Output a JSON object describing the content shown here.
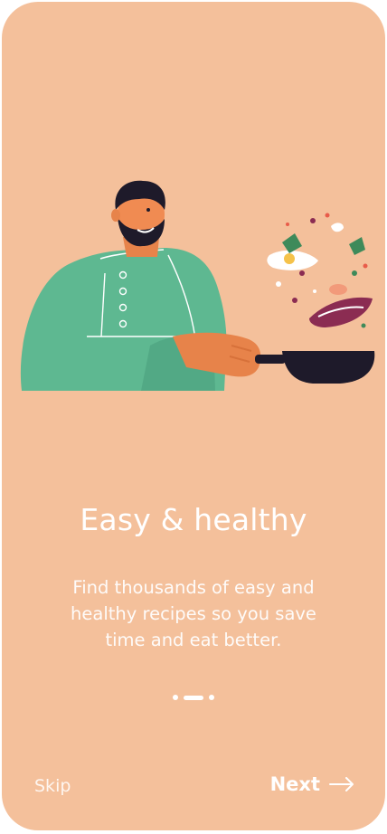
{
  "onboarding": {
    "title": "Easy & healthy",
    "description": "Find thousands of easy and healthy recipes so you save time and eat better.",
    "pagination": {
      "total": 3,
      "active_index": 1
    }
  },
  "footer": {
    "skip_label": "Skip",
    "next_label": "Next",
    "next_icon": "arrow-right-icon"
  },
  "colors": {
    "background": "#F4C09B",
    "chef_jacket": "#5EB891",
    "pan": "#1E1A2A",
    "text": "#FFFFFF"
  }
}
